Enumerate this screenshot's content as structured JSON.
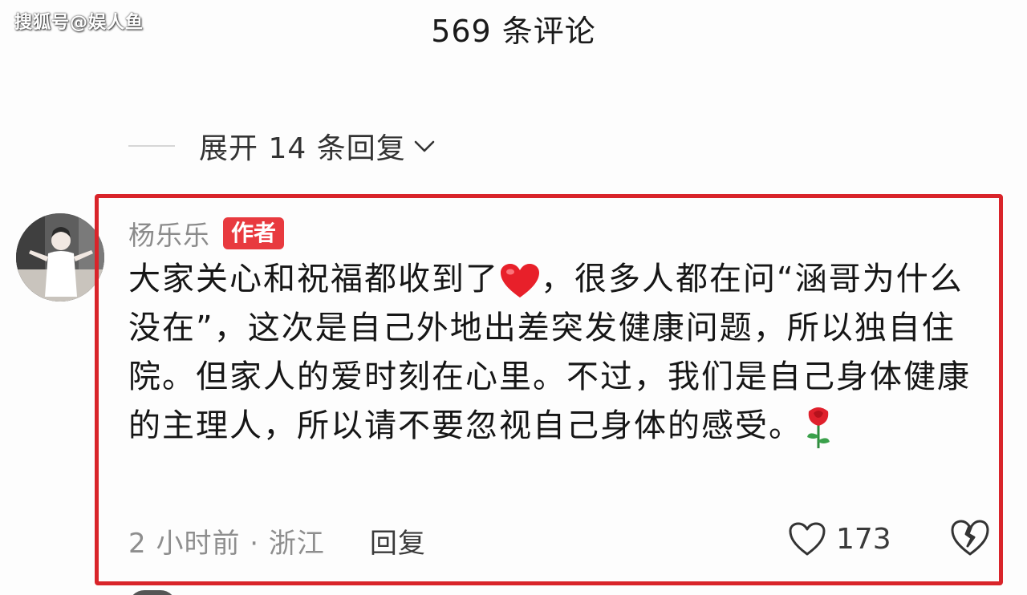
{
  "watermark": "搜狐号@娱人鱼",
  "sheet": {
    "title": "569 条评论"
  },
  "replies": {
    "expand_label": "展开 14 条回复"
  },
  "comment": {
    "author": "杨乐乐",
    "author_badge": "作者",
    "text_part1": "大家关心和祝福都收到了",
    "text_part2": "，很多人都在问“涵哥为什么没在”，这次是自己外地出差突发健康问题，所以独自住院。但家人的爱时刻在心里。不过，我们是自己身体健康的主理人，所以请不要忽视自己身体的感受。",
    "emoji_heart": "heart-emoji",
    "emoji_rose": "rose-emoji",
    "meta": "2 小时前 · 浙江",
    "reply_label": "回复",
    "like_count": "173"
  },
  "colors": {
    "highlight": "#d9242a",
    "badge": "#e83a3f"
  }
}
